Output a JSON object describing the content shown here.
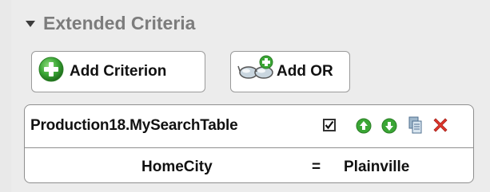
{
  "section": {
    "title": "Extended Criteria"
  },
  "buttons": {
    "add_criterion": "Add Criterion",
    "add_or": "Add OR"
  },
  "criteria": [
    {
      "table": "Production18.MySearchTable",
      "enabled": true,
      "field": "HomeCity",
      "operator": "=",
      "value": "Plainville"
    }
  ],
  "icons": {
    "expand": "triangle-down-icon",
    "add_criterion": "green-plus-icon",
    "add_or": "glasses-plus-icon",
    "move_up": "green-up-arrow-icon",
    "move_down": "green-down-arrow-icon",
    "copy": "copy-icon",
    "delete": "red-x-icon"
  },
  "colors": {
    "accent_green": "#3aa635",
    "delete_red": "#e0342a",
    "header_text": "#7c7c7c"
  }
}
